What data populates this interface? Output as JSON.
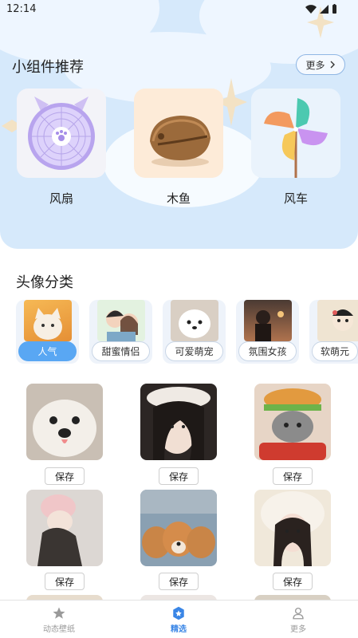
{
  "status_bar": {
    "time": "12:14"
  },
  "widgets": {
    "title": "小组件推荐",
    "more_label": "更多",
    "items": [
      {
        "label": "风扇",
        "icon": "fan-icon"
      },
      {
        "label": "木鱼",
        "icon": "wooden-fish-icon"
      },
      {
        "label": "风车",
        "icon": "pinwheel-icon"
      }
    ]
  },
  "avatar_categories": {
    "title": "头像分类",
    "items": [
      {
        "label": "人气",
        "active": true
      },
      {
        "label": "甜蜜情侣",
        "active": false
      },
      {
        "label": "可爱萌宠",
        "active": false
      },
      {
        "label": "氛围女孩",
        "active": false
      },
      {
        "label": "软萌元",
        "active": false
      }
    ]
  },
  "grid": {
    "save_label": "保存",
    "rows": 3
  },
  "bottom_nav": {
    "items": [
      {
        "label": "动态壁纸",
        "icon": "star-icon",
        "active": false
      },
      {
        "label": "精选",
        "icon": "badge-star-icon",
        "active": true
      },
      {
        "label": "更多",
        "icon": "person-icon",
        "active": false
      }
    ]
  },
  "colors": {
    "accent": "#59a7f3",
    "hero_bg": "#d6e9fb"
  }
}
